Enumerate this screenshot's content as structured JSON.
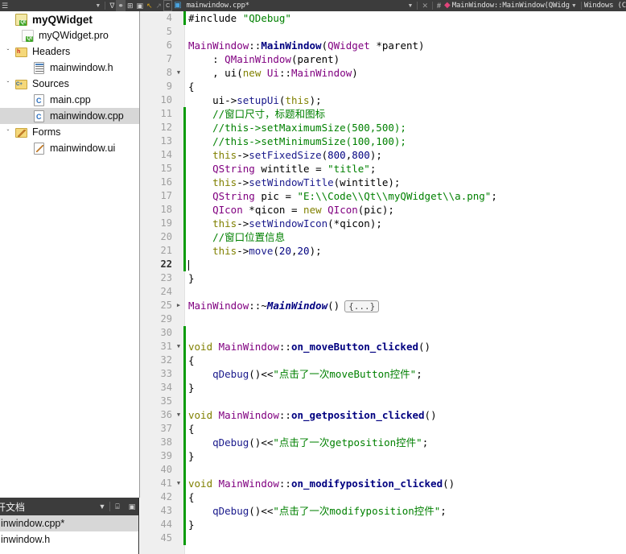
{
  "toolbar": {
    "left_buttons": [
      {
        "name": "menu-icon",
        "glyph": "☰"
      },
      {
        "name": "chevron-down-icon",
        "glyph": "▼"
      },
      {
        "name": "filter-icon",
        "glyph": "∇"
      },
      {
        "name": "link-icon",
        "glyph": "⚭",
        "selected": true
      },
      {
        "name": "split-add-icon",
        "glyph": "⊞"
      },
      {
        "name": "close-split-icon",
        "glyph": "▣"
      }
    ],
    "back_glyph": "↖",
    "forward_glyph": "↗",
    "file_icon_glyph": "C",
    "filename": "mainwindow.cpp*",
    "filename_caret": "▼",
    "close_glyph": "✕",
    "hash_glyph": "#",
    "bookmark_glyph": "◆",
    "symbol": "MainWindow::MainWindow(QWidg",
    "symbol_caret": "▼",
    "line_ending": "Windows (C"
  },
  "sidebar": {
    "items": [
      {
        "label": "myQWidget",
        "icon": "qt-project-icon",
        "indent": 0,
        "arrow": "",
        "bold": true,
        "selected": false
      },
      {
        "label": "myQWidget.pro",
        "icon": "qt-pro-file-icon",
        "indent": 1,
        "arrow": "",
        "bold": false,
        "selected": false
      },
      {
        "label": "Headers",
        "icon": "headers-folder-icon",
        "indent": 0,
        "arrow": "ˇ",
        "bold": false,
        "selected": false
      },
      {
        "label": "mainwindow.h",
        "icon": "header-file-icon",
        "indent": 1,
        "arrow": "",
        "bold": false,
        "selected": false
      },
      {
        "label": "Sources",
        "icon": "sources-folder-icon",
        "indent": 0,
        "arrow": "ˇ",
        "bold": false,
        "selected": false
      },
      {
        "label": "main.cpp",
        "icon": "cpp-file-icon",
        "indent": 1,
        "arrow": "",
        "bold": false,
        "selected": false
      },
      {
        "label": "mainwindow.cpp",
        "icon": "cpp-file-icon",
        "indent": 1,
        "arrow": "",
        "bold": false,
        "selected": true
      },
      {
        "label": "Forms",
        "icon": "forms-folder-icon",
        "indent": 0,
        "arrow": "ˇ",
        "bold": false,
        "selected": false
      },
      {
        "label": "mainwindow.ui",
        "icon": "ui-file-icon",
        "indent": 1,
        "arrow": "",
        "bold": false,
        "selected": false
      }
    ]
  },
  "open_documents": {
    "title": "开文档",
    "dropdown_glyph": "▼",
    "split_glyph": "⌸",
    "close_glyph": "▣",
    "scroll_up_glyph": "▲",
    "items": [
      {
        "label": "inwindow.cpp*",
        "selected": true
      },
      {
        "label": "inwindow.h",
        "selected": false
      }
    ]
  },
  "editor": {
    "cursor_line": 22,
    "fold_collapsed_label": "{...}",
    "lines": [
      {
        "n": 4,
        "fold": "",
        "changed": true,
        "html": "<span class=\"pre\">#include</span> <span class=\"str\">\"QDebug\"</span>"
      },
      {
        "n": 5,
        "fold": "",
        "changed": false,
        "html": ""
      },
      {
        "n": 6,
        "fold": "",
        "changed": false,
        "html": "<span class=\"typ\">MainWindow</span><span class=\"op\">::</span><span class=\"fn\">MainWindow</span><span class=\"op\">(</span><span class=\"typ\">QWidget</span> <span class=\"op\">*</span><span class=\"var\">parent</span><span class=\"op\">)</span>"
      },
      {
        "n": 7,
        "fold": "",
        "changed": false,
        "html": "    <span class=\"op\">: </span><span class=\"typ\">QMainWindow</span><span class=\"op\">(</span><span class=\"var\">parent</span><span class=\"op\">)</span>"
      },
      {
        "n": 8,
        "fold": "▼",
        "changed": false,
        "html": "    <span class=\"op\">, </span><span class=\"var\">ui</span><span class=\"op\">(</span><span class=\"k\">new</span> <span class=\"typ\">Ui</span><span class=\"op\">::</span><span class=\"typ\">MainWindow</span><span class=\"op\">)</span>"
      },
      {
        "n": 9,
        "fold": "",
        "changed": false,
        "html": "<span class=\"op\">{</span>"
      },
      {
        "n": 10,
        "fold": "",
        "changed": false,
        "html": "    <span class=\"var\">ui</span><span class=\"op\">-&gt;</span><span class=\"fnv\">setupUi</span><span class=\"op\">(</span><span class=\"k\">this</span><span class=\"op\">);</span>"
      },
      {
        "n": 11,
        "fold": "",
        "changed": true,
        "html": "    <span class=\"cmt\">//窗口尺寸，标题和图标</span>"
      },
      {
        "n": 12,
        "fold": "",
        "changed": true,
        "html": "    <span class=\"cmt\">//this-&gt;setMaximumSize(500,500);</span>"
      },
      {
        "n": 13,
        "fold": "",
        "changed": true,
        "html": "    <span class=\"cmt\">//this-&gt;setMinimumSize(100,100);</span>"
      },
      {
        "n": 14,
        "fold": "",
        "changed": true,
        "html": "    <span class=\"k\">this</span><span class=\"op\">-&gt;</span><span class=\"fnv\">setFixedSize</span><span class=\"op\">(</span><span class=\"num\">800</span><span class=\"op\">,</span><span class=\"num\">800</span><span class=\"op\">);</span>"
      },
      {
        "n": 15,
        "fold": "",
        "changed": true,
        "html": "    <span class=\"typ\">QString</span> <span class=\"var\">wintitle</span> <span class=\"op\">= </span><span class=\"str\">\"title\"</span><span class=\"op\">;</span>"
      },
      {
        "n": 16,
        "fold": "",
        "changed": true,
        "html": "    <span class=\"k\">this</span><span class=\"op\">-&gt;</span><span class=\"fnv\">setWindowTitle</span><span class=\"op\">(</span><span class=\"var\">wintitle</span><span class=\"op\">);</span>"
      },
      {
        "n": 17,
        "fold": "",
        "changed": true,
        "html": "    <span class=\"typ\">QString</span> <span class=\"var\">pic</span> <span class=\"op\">= </span><span class=\"str\">\"E:\\\\Code\\\\Qt\\\\myQWidget\\\\a.png\"</span><span class=\"op\">;</span>"
      },
      {
        "n": 18,
        "fold": "",
        "changed": true,
        "html": "    <span class=\"typ\">QIcon</span> <span class=\"op\">*</span><span class=\"var\">qicon</span> <span class=\"op\">= </span><span class=\"k\">new</span> <span class=\"typ\">QIcon</span><span class=\"op\">(</span><span class=\"var\">pic</span><span class=\"op\">);</span>"
      },
      {
        "n": 19,
        "fold": "",
        "changed": true,
        "html": "    <span class=\"k\">this</span><span class=\"op\">-&gt;</span><span class=\"fnv\">setWindowIcon</span><span class=\"op\">(</span><span class=\"op\">*</span><span class=\"var\">qicon</span><span class=\"op\">);</span>"
      },
      {
        "n": 20,
        "fold": "",
        "changed": true,
        "html": "    <span class=\"cmt\">//窗口位置信息</span>"
      },
      {
        "n": 21,
        "fold": "",
        "changed": true,
        "html": "    <span class=\"k\">this</span><span class=\"op\">-&gt;</span><span class=\"fnv\">move</span><span class=\"op\">(</span><span class=\"num\">20</span><span class=\"op\">,</span><span class=\"num\">20</span><span class=\"op\">);</span>"
      },
      {
        "n": 22,
        "fold": "",
        "changed": true,
        "html": "<span class=\"caret\"></span>"
      },
      {
        "n": 23,
        "fold": "",
        "changed": false,
        "html": "<span class=\"op\">}</span>"
      },
      {
        "n": 24,
        "fold": "",
        "changed": false,
        "html": ""
      },
      {
        "n": 25,
        "fold": "▶",
        "changed": false,
        "html": "<span class=\"typ\">MainWindow</span><span class=\"op\">::~</span><span class=\"dtor\">MainWindow</span><span class=\"op\">()</span><span class=\"foldbox\">{...}</span>"
      },
      {
        "n": 29,
        "fold": "",
        "changed": false,
        "html": ""
      },
      {
        "n": 30,
        "fold": "",
        "changed": true,
        "html": ""
      },
      {
        "n": 31,
        "fold": "▼",
        "changed": true,
        "html": "<span class=\"k\">void</span> <span class=\"typ\">MainWindow</span><span class=\"op\">::</span><span class=\"fn\">on_moveButton_clicked</span><span class=\"op\">()</span>"
      },
      {
        "n": 32,
        "fold": "",
        "changed": true,
        "html": "<span class=\"op\">{</span>"
      },
      {
        "n": 33,
        "fold": "",
        "changed": true,
        "html": "    <span class=\"fnv\">qDebug</span><span class=\"op\">()&lt;&lt;</span><span class=\"str\">\"点击了一次moveButton控件\"</span><span class=\"op\">;</span>"
      },
      {
        "n": 34,
        "fold": "",
        "changed": true,
        "html": "<span class=\"op\">}</span>"
      },
      {
        "n": 35,
        "fold": "",
        "changed": true,
        "html": ""
      },
      {
        "n": 36,
        "fold": "▼",
        "changed": true,
        "html": "<span class=\"k\">void</span> <span class=\"typ\">MainWindow</span><span class=\"op\">::</span><span class=\"fn\">on_getposition_clicked</span><span class=\"op\">()</span>"
      },
      {
        "n": 37,
        "fold": "",
        "changed": true,
        "html": "<span class=\"op\">{</span>"
      },
      {
        "n": 38,
        "fold": "",
        "changed": true,
        "html": "    <span class=\"fnv\">qDebug</span><span class=\"op\">()&lt;&lt;</span><span class=\"str\">\"点击了一次getposition控件\"</span><span class=\"op\">;</span>"
      },
      {
        "n": 39,
        "fold": "",
        "changed": true,
        "html": "<span class=\"op\">}</span>"
      },
      {
        "n": 40,
        "fold": "",
        "changed": true,
        "html": ""
      },
      {
        "n": 41,
        "fold": "▼",
        "changed": true,
        "html": "<span class=\"k\">void</span> <span class=\"typ\">MainWindow</span><span class=\"op\">::</span><span class=\"fn\">on_modifyposition_clicked</span><span class=\"op\">()</span>"
      },
      {
        "n": 42,
        "fold": "",
        "changed": true,
        "html": "<span class=\"op\">{</span>"
      },
      {
        "n": 43,
        "fold": "",
        "changed": true,
        "html": "    <span class=\"fnv\">qDebug</span><span class=\"op\">()&lt;&lt;</span><span class=\"str\">\"点击了一次modifyposition控件\"</span><span class=\"op\">;</span>"
      },
      {
        "n": 44,
        "fold": "",
        "changed": true,
        "html": "<span class=\"op\">}</span>"
      },
      {
        "n": 45,
        "fold": "",
        "changed": true,
        "html": ""
      }
    ]
  },
  "colors": {
    "toolbar_bg": "#3c3c3c",
    "gutter_bg": "#efefef",
    "selection_bg": "#d7d7d7",
    "change_marker": "#0a9b0a",
    "string": "#008000",
    "comment": "#008000",
    "type": "#800080",
    "keyword": "#808000",
    "function": "#000080"
  }
}
